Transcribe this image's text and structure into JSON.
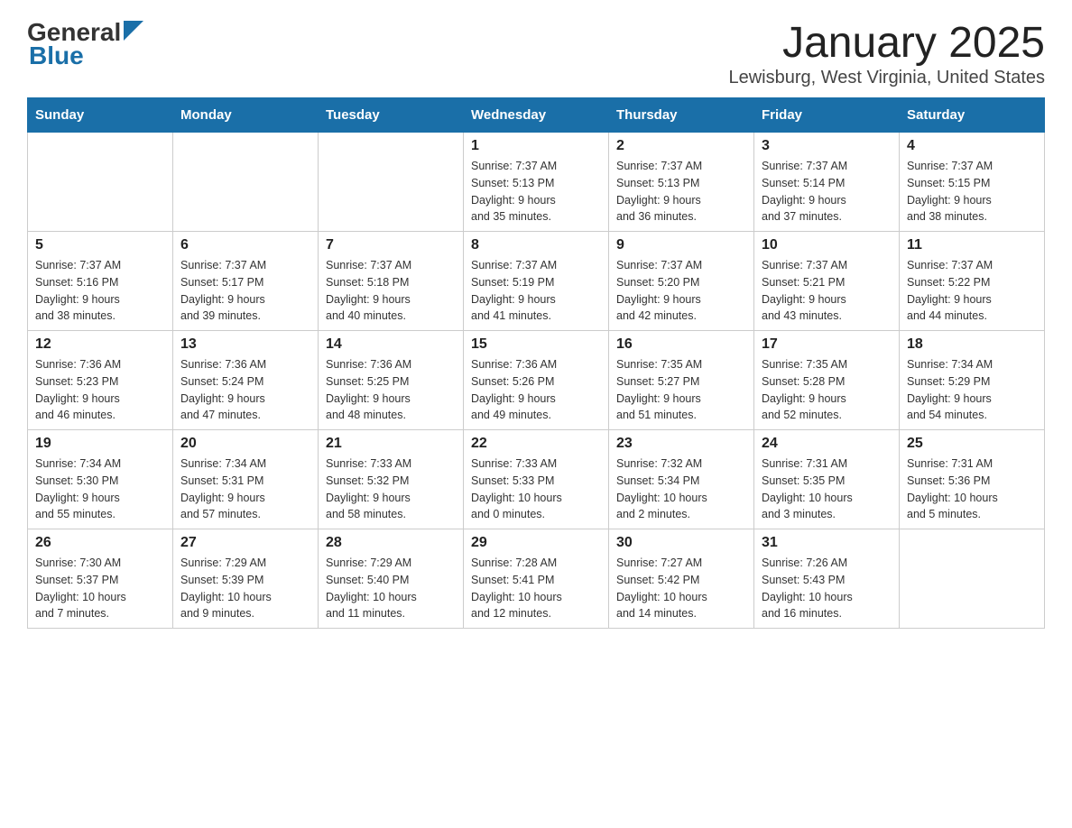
{
  "logo": {
    "general": "General",
    "blue": "Blue"
  },
  "title": "January 2025",
  "subtitle": "Lewisburg, West Virginia, United States",
  "weekdays": [
    "Sunday",
    "Monday",
    "Tuesday",
    "Wednesday",
    "Thursday",
    "Friday",
    "Saturday"
  ],
  "weeks": [
    [
      {
        "day": "",
        "info": ""
      },
      {
        "day": "",
        "info": ""
      },
      {
        "day": "",
        "info": ""
      },
      {
        "day": "1",
        "info": "Sunrise: 7:37 AM\nSunset: 5:13 PM\nDaylight: 9 hours\nand 35 minutes."
      },
      {
        "day": "2",
        "info": "Sunrise: 7:37 AM\nSunset: 5:13 PM\nDaylight: 9 hours\nand 36 minutes."
      },
      {
        "day": "3",
        "info": "Sunrise: 7:37 AM\nSunset: 5:14 PM\nDaylight: 9 hours\nand 37 minutes."
      },
      {
        "day": "4",
        "info": "Sunrise: 7:37 AM\nSunset: 5:15 PM\nDaylight: 9 hours\nand 38 minutes."
      }
    ],
    [
      {
        "day": "5",
        "info": "Sunrise: 7:37 AM\nSunset: 5:16 PM\nDaylight: 9 hours\nand 38 minutes."
      },
      {
        "day": "6",
        "info": "Sunrise: 7:37 AM\nSunset: 5:17 PM\nDaylight: 9 hours\nand 39 minutes."
      },
      {
        "day": "7",
        "info": "Sunrise: 7:37 AM\nSunset: 5:18 PM\nDaylight: 9 hours\nand 40 minutes."
      },
      {
        "day": "8",
        "info": "Sunrise: 7:37 AM\nSunset: 5:19 PM\nDaylight: 9 hours\nand 41 minutes."
      },
      {
        "day": "9",
        "info": "Sunrise: 7:37 AM\nSunset: 5:20 PM\nDaylight: 9 hours\nand 42 minutes."
      },
      {
        "day": "10",
        "info": "Sunrise: 7:37 AM\nSunset: 5:21 PM\nDaylight: 9 hours\nand 43 minutes."
      },
      {
        "day": "11",
        "info": "Sunrise: 7:37 AM\nSunset: 5:22 PM\nDaylight: 9 hours\nand 44 minutes."
      }
    ],
    [
      {
        "day": "12",
        "info": "Sunrise: 7:36 AM\nSunset: 5:23 PM\nDaylight: 9 hours\nand 46 minutes."
      },
      {
        "day": "13",
        "info": "Sunrise: 7:36 AM\nSunset: 5:24 PM\nDaylight: 9 hours\nand 47 minutes."
      },
      {
        "day": "14",
        "info": "Sunrise: 7:36 AM\nSunset: 5:25 PM\nDaylight: 9 hours\nand 48 minutes."
      },
      {
        "day": "15",
        "info": "Sunrise: 7:36 AM\nSunset: 5:26 PM\nDaylight: 9 hours\nand 49 minutes."
      },
      {
        "day": "16",
        "info": "Sunrise: 7:35 AM\nSunset: 5:27 PM\nDaylight: 9 hours\nand 51 minutes."
      },
      {
        "day": "17",
        "info": "Sunrise: 7:35 AM\nSunset: 5:28 PM\nDaylight: 9 hours\nand 52 minutes."
      },
      {
        "day": "18",
        "info": "Sunrise: 7:34 AM\nSunset: 5:29 PM\nDaylight: 9 hours\nand 54 minutes."
      }
    ],
    [
      {
        "day": "19",
        "info": "Sunrise: 7:34 AM\nSunset: 5:30 PM\nDaylight: 9 hours\nand 55 minutes."
      },
      {
        "day": "20",
        "info": "Sunrise: 7:34 AM\nSunset: 5:31 PM\nDaylight: 9 hours\nand 57 minutes."
      },
      {
        "day": "21",
        "info": "Sunrise: 7:33 AM\nSunset: 5:32 PM\nDaylight: 9 hours\nand 58 minutes."
      },
      {
        "day": "22",
        "info": "Sunrise: 7:33 AM\nSunset: 5:33 PM\nDaylight: 10 hours\nand 0 minutes."
      },
      {
        "day": "23",
        "info": "Sunrise: 7:32 AM\nSunset: 5:34 PM\nDaylight: 10 hours\nand 2 minutes."
      },
      {
        "day": "24",
        "info": "Sunrise: 7:31 AM\nSunset: 5:35 PM\nDaylight: 10 hours\nand 3 minutes."
      },
      {
        "day": "25",
        "info": "Sunrise: 7:31 AM\nSunset: 5:36 PM\nDaylight: 10 hours\nand 5 minutes."
      }
    ],
    [
      {
        "day": "26",
        "info": "Sunrise: 7:30 AM\nSunset: 5:37 PM\nDaylight: 10 hours\nand 7 minutes."
      },
      {
        "day": "27",
        "info": "Sunrise: 7:29 AM\nSunset: 5:39 PM\nDaylight: 10 hours\nand 9 minutes."
      },
      {
        "day": "28",
        "info": "Sunrise: 7:29 AM\nSunset: 5:40 PM\nDaylight: 10 hours\nand 11 minutes."
      },
      {
        "day": "29",
        "info": "Sunrise: 7:28 AM\nSunset: 5:41 PM\nDaylight: 10 hours\nand 12 minutes."
      },
      {
        "day": "30",
        "info": "Sunrise: 7:27 AM\nSunset: 5:42 PM\nDaylight: 10 hours\nand 14 minutes."
      },
      {
        "day": "31",
        "info": "Sunrise: 7:26 AM\nSunset: 5:43 PM\nDaylight: 10 hours\nand 16 minutes."
      },
      {
        "day": "",
        "info": ""
      }
    ]
  ]
}
